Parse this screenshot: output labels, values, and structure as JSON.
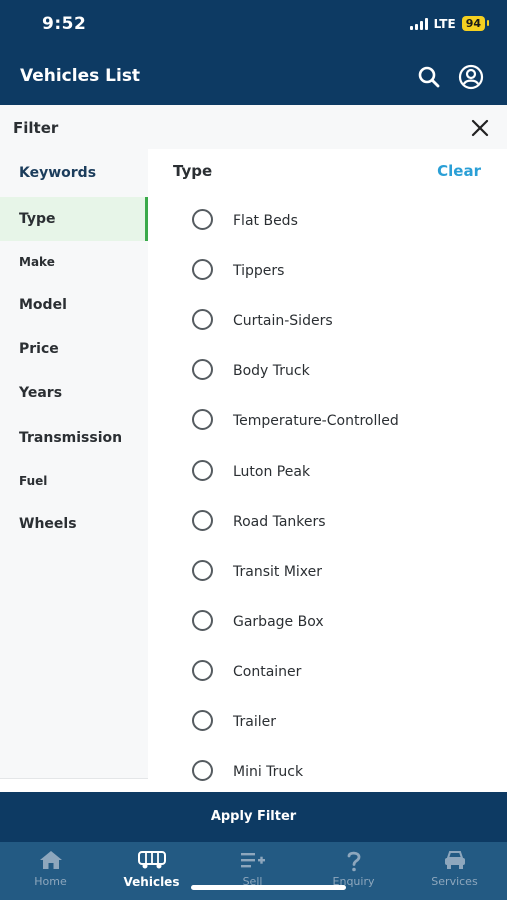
{
  "status_bar": {
    "time": "9:52",
    "network": "LTE",
    "battery": "94"
  },
  "header": {
    "title": "Vehicles List",
    "icons": [
      "search-icon",
      "profile-icon"
    ]
  },
  "filter": {
    "title": "Filter",
    "close_icon": "close-icon"
  },
  "sidebar": {
    "items": [
      {
        "label": "Keywords"
      },
      {
        "label": "Type"
      },
      {
        "label": "Make"
      },
      {
        "label": "Model"
      },
      {
        "label": "Price"
      },
      {
        "label": "Years"
      },
      {
        "label": "Transmission"
      },
      {
        "label": "Fuel"
      },
      {
        "label": "Wheels"
      }
    ],
    "selected": "Type"
  },
  "panel": {
    "title": "Type",
    "clear_label": "Clear",
    "options": [
      {
        "label": "Flat Beds"
      },
      {
        "label": "Tippers"
      },
      {
        "label": "Curtain-Siders"
      },
      {
        "label": "Body Truck"
      },
      {
        "label": "Temperature-Controlled"
      },
      {
        "label": "Luton Peak"
      },
      {
        "label": "Road Tankers"
      },
      {
        "label": "Transit Mixer"
      },
      {
        "label": "Garbage Box"
      },
      {
        "label": "Container"
      },
      {
        "label": "Trailer"
      },
      {
        "label": "Mini Truck"
      }
    ]
  },
  "apply_button": {
    "label": "Apply Filter"
  },
  "tabbar": {
    "tabs": [
      {
        "label": "Home",
        "icon": "home-icon"
      },
      {
        "label": "Vehicles",
        "icon": "vehicles-icon"
      },
      {
        "label": "Sell",
        "icon": "sell-icon"
      },
      {
        "label": "Enquiry",
        "icon": "enquiry-icon"
      },
      {
        "label": "Services",
        "icon": "services-icon"
      }
    ],
    "active": "Vehicles"
  },
  "colors": {
    "header_bg": "#0d3a63",
    "tabbar_bg": "#235a83",
    "accent_green": "#3aaa4a",
    "clear_blue": "#2a9fd6",
    "battery_yellow": "#f5d020"
  }
}
